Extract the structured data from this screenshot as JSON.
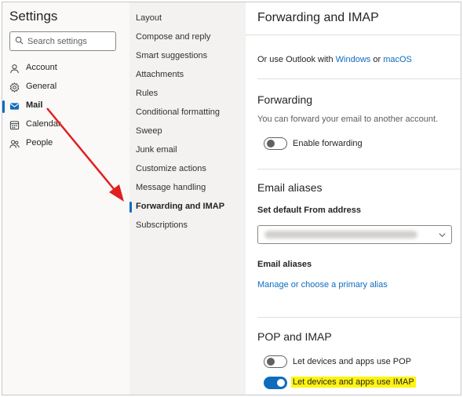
{
  "app": {
    "title": "Settings"
  },
  "search": {
    "placeholder": "Search settings"
  },
  "categories": [
    {
      "label": "Account",
      "icon": "person-icon",
      "active": false
    },
    {
      "label": "General",
      "icon": "gear-icon",
      "active": false
    },
    {
      "label": "Mail",
      "icon": "mail-icon",
      "active": true
    },
    {
      "label": "Calendar",
      "icon": "calendar-icon",
      "active": false
    },
    {
      "label": "People",
      "icon": "people-icon",
      "active": false
    }
  ],
  "mail_nav": [
    {
      "label": "Layout",
      "active": false
    },
    {
      "label": "Compose and reply",
      "active": false
    },
    {
      "label": "Smart suggestions",
      "active": false
    },
    {
      "label": "Attachments",
      "active": false
    },
    {
      "label": "Rules",
      "active": false
    },
    {
      "label": "Conditional formatting",
      "active": false
    },
    {
      "label": "Sweep",
      "active": false
    },
    {
      "label": "Junk email",
      "active": false
    },
    {
      "label": "Customize actions",
      "active": false
    },
    {
      "label": "Message handling",
      "active": false
    },
    {
      "label": "Forwarding and IMAP",
      "active": true
    },
    {
      "label": "Subscriptions",
      "active": false
    }
  ],
  "panel": {
    "title": "Forwarding and IMAP",
    "outlook_line": {
      "prefix": "Or use Outlook with",
      "windows": "Windows",
      "or": "or",
      "macos": "macOS"
    },
    "forwarding": {
      "title": "Forwarding",
      "description": "You can forward your email to another account.",
      "toggle_label": "Enable forwarding",
      "enabled": false
    },
    "aliases": {
      "title": "Email aliases",
      "from_label": "Set default From address",
      "aliases_label": "Email aliases",
      "manage_link": "Manage or choose a primary alias"
    },
    "pop_imap": {
      "title": "POP and IMAP",
      "pop_label": "Let devices and apps use POP",
      "pop_enabled": false,
      "imap_label": "Let devices and apps use IMAP",
      "imap_enabled": true
    }
  },
  "colors": {
    "accent": "#0f6cbd",
    "highlight": "#fff40f",
    "annotation_arrow": "#e02020"
  }
}
